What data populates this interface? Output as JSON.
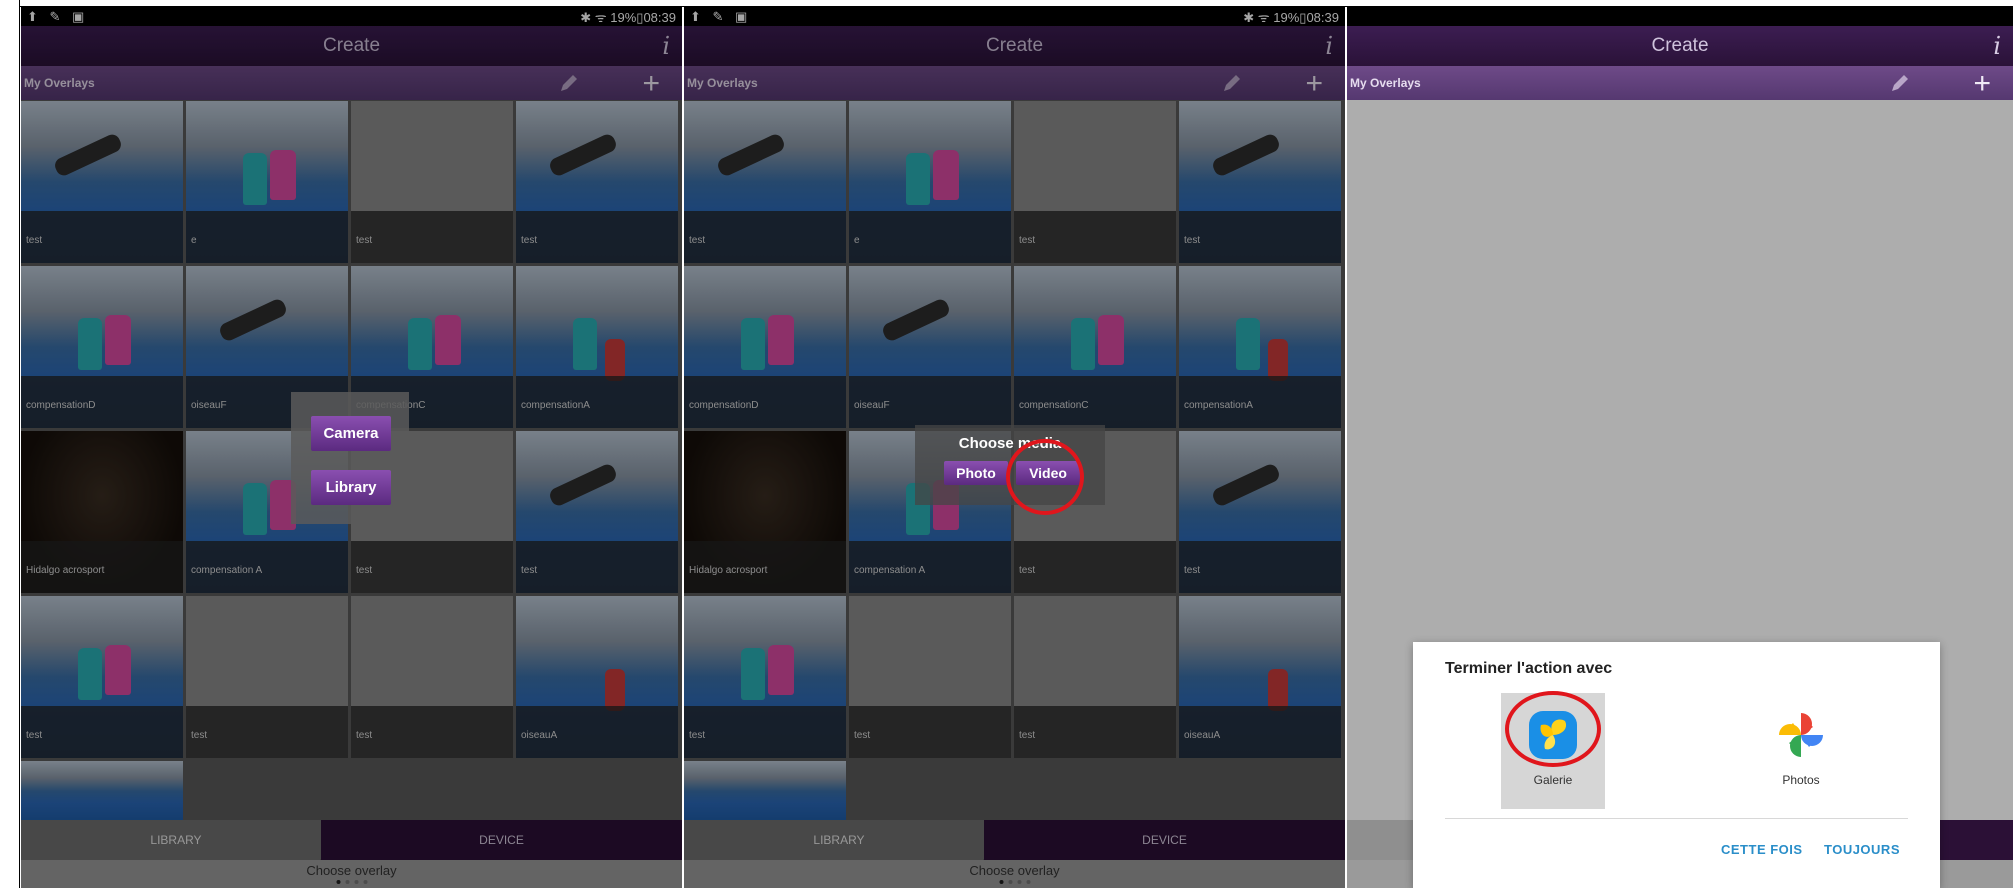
{
  "status": {
    "left": "⬆ ✎ ▣",
    "right": "✱ ᯤ 19%▯08:39"
  },
  "header": {
    "title": "Create",
    "info": "i"
  },
  "subheader": {
    "label": "My Overlays"
  },
  "tiles": [
    [
      "test",
      "e",
      "test",
      "test"
    ],
    [
      "compensationD",
      "oiseauF",
      "compensationC",
      "compensationA"
    ],
    [
      "Hidalgo acrosport",
      "compensation A",
      "test",
      "test"
    ],
    [
      "test",
      "test",
      "test",
      "oiseauA"
    ]
  ],
  "tabs": {
    "library": "LIBRARY",
    "device": "DEVICE"
  },
  "footer": {
    "label": "Choose overlay"
  },
  "popup1": {
    "camera": "Camera",
    "library": "Library"
  },
  "popup2": {
    "title": "Choose media",
    "photo": "Photo",
    "video": "Video"
  },
  "dialog": {
    "title": "Terminer l'action avec",
    "apps": [
      {
        "name": "Galerie",
        "icon": "gallery-icon"
      },
      {
        "name": "Photos",
        "icon": "pinwheel-icon"
      }
    ],
    "once": "CETTE FOIS",
    "always": "TOUJOURS"
  },
  "colors": {
    "purple_header": "#3c1d52",
    "purple_bar": "#6e4a88",
    "accent_blue": "#2a8ec9",
    "ring_red": "#e0161c"
  }
}
